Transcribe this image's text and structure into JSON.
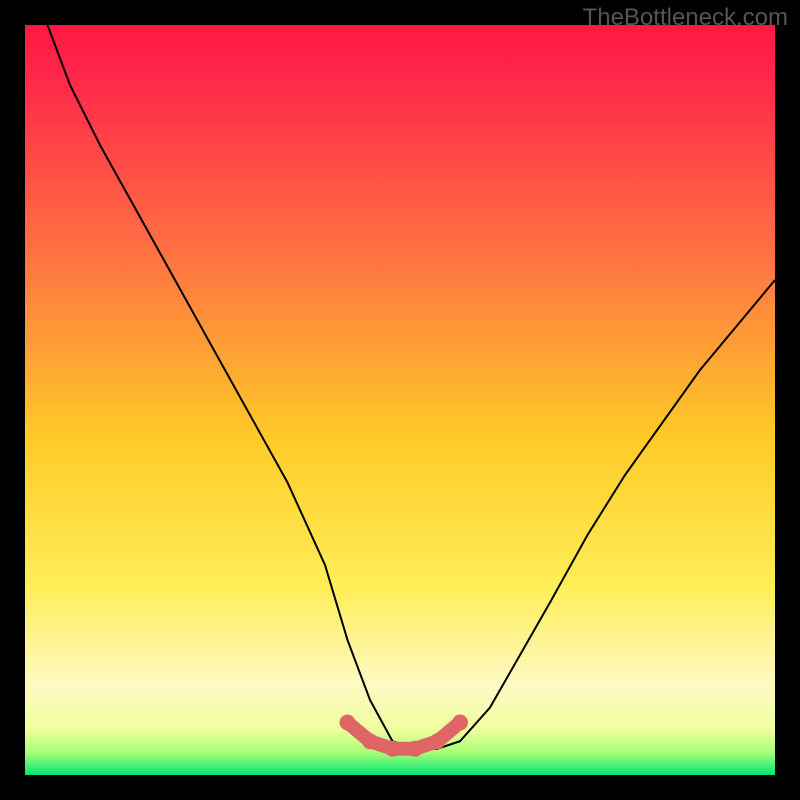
{
  "watermark": "TheBottleneck.com",
  "chart_data": {
    "type": "line",
    "title": "",
    "xlabel": "",
    "ylabel": "",
    "xlim": [
      0,
      100
    ],
    "ylim": [
      0,
      100
    ],
    "gradient_colors": {
      "top": "#ff1744",
      "upper_mid": "#ff6e40",
      "mid": "#ffd740",
      "lower_mid": "#ffff8d",
      "bottom": "#00e676"
    },
    "series": [
      {
        "name": "curve",
        "color": "#000000",
        "x": [
          3,
          6,
          10,
          15,
          20,
          25,
          30,
          35,
          40,
          43,
          46,
          49,
          52,
          55,
          58,
          62,
          66,
          70,
          75,
          80,
          85,
          90,
          95,
          100
        ],
        "y": [
          100,
          92,
          84,
          75,
          66,
          57,
          48,
          39,
          28,
          18,
          10,
          4.5,
          3.5,
          3.5,
          4.5,
          9,
          16,
          23,
          32,
          40,
          47,
          54,
          60,
          66
        ]
      },
      {
        "name": "highlight",
        "color": "#e06666",
        "x": [
          43,
          46,
          49,
          52,
          55,
          58
        ],
        "y": [
          7,
          4.5,
          3.5,
          3.5,
          4.5,
          7
        ]
      }
    ]
  }
}
